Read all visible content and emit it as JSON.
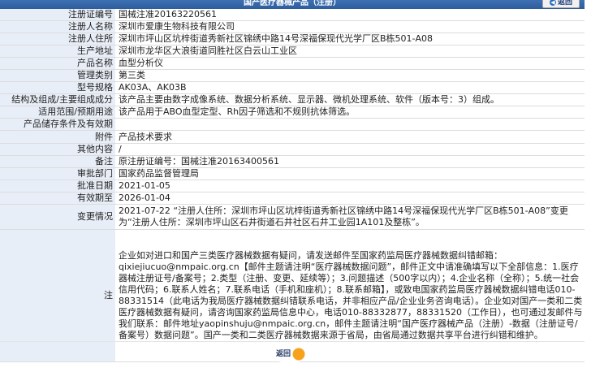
{
  "header": {
    "title": "国产医疗器械产品（注册）",
    "back_label": "返回"
  },
  "rows": [
    {
      "label": "注册证编号",
      "value": "国械注准20163220561"
    },
    {
      "label": "注册人名称",
      "value": "深圳市爱康生物科技有限公司"
    },
    {
      "label": "注册人住所",
      "value": "深圳市坪山区坑梓街道秀新社区锦绣中路14号深福保现代光学厂区B栋501-A08"
    },
    {
      "label": "生产地址",
      "value": "深圳市龙华区大浪街道同胜社区白云山工业区"
    },
    {
      "label": "产品名称",
      "value": "血型分析仪"
    },
    {
      "label": "管理类别",
      "value": "第三类"
    },
    {
      "label": "型号规格",
      "value": "AK03A、AK03B"
    },
    {
      "label": "结构及组成/主要组成成分",
      "value": "该产品主要由数字成像系统、数据分析系统、显示器、微机处理系统、软件（版本号：3）组成。"
    },
    {
      "label": "适用范围/预期用途",
      "value": "该产品用于ABO血型定型、Rh因子筛选和不规则抗体筛选。"
    },
    {
      "label": "产品储存条件及有效期",
      "value": ""
    },
    {
      "label": "附件",
      "value": "产品技术要求"
    },
    {
      "label": "其他内容",
      "value": "/"
    },
    {
      "label": "备注",
      "value": "原注册证编号：国械注准20163400561"
    },
    {
      "label": "审批部门",
      "value": "国家药品监督管理局"
    },
    {
      "label": "批准日期",
      "value": "2021-01-05"
    },
    {
      "label": "有效期至",
      "value": "2026-01-04"
    },
    {
      "label": "变更情况",
      "value": "2021-07-22 “注册人住所：深圳市坪山区坑梓街道秀新社区锦绣中路14号深福保现代光学厂区B栋501-A08”变更为“注册人住所：深圳市坪山区石井街道石井社区石井工业园1A101及整栋”。"
    },
    {
      "label": "注",
      "value": "企业如对进口和国产三类医疗器械数据有疑问，请发送邮件至国家药监局医疗器械数据纠错邮箱：qixiejiucuo@nmpaic.org.cn【邮件主题请注明“医疗器械数据问题”，邮件正文中请准确填写以下全部信息：1.医疗器械注册证号/备案号；2.类型（注册、变更、延续等）；3.问题描述（500字以内）；4.企业名称（全称）；5.统一社会信用代码；6.联系人姓名；7.联系电话（手机和座机）；8.联系邮箱】，或致电国家药监局医疗器械数据纠错电话010-88331514（此电话为我局医疗器械数据纠错联系电话，并非相应产品/企业业务咨询电话）。企业如对国产一类和二类医疗器械数据有疑问，请咨询国家药监局信息中心，电话010-88332877，88331520（工作日），也可通过发邮件与我们联系：邮件地址yaopinshuju@nmpaic.org.cn，邮件主题请注明“国产医疗器械产品（注册）-数据（注册证号/备案号）数据问题”。国产一类和二类医疗器械数据来源于省局，由省局通过数据共享平台进行纠错和维护。"
    }
  ],
  "footer": {
    "back_label": "返回"
  }
}
